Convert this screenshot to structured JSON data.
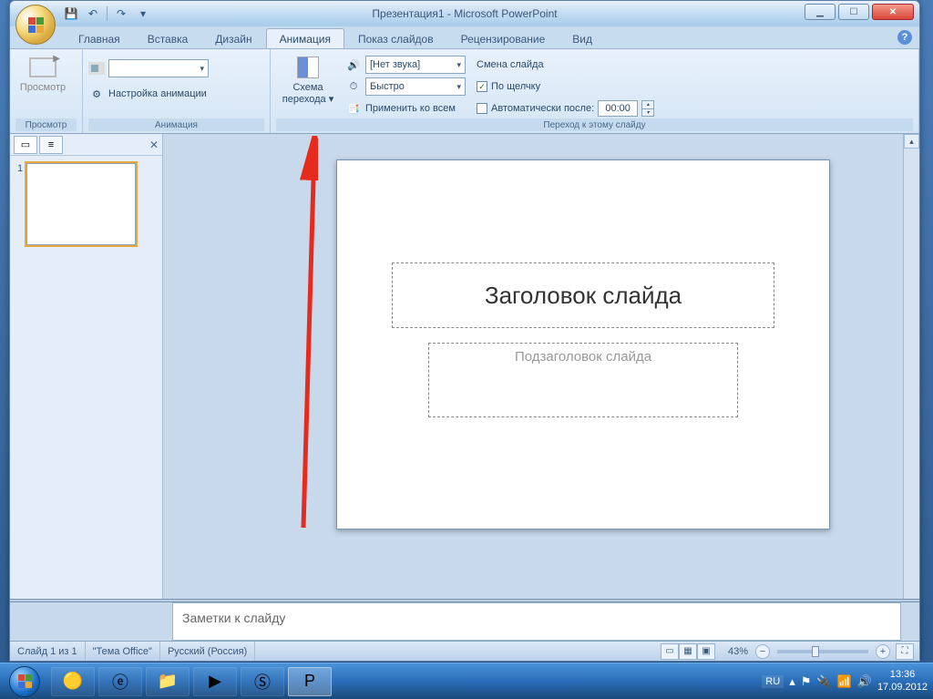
{
  "window": {
    "title": "Презентация1 - Microsoft PowerPoint"
  },
  "qat": {
    "save": "💾",
    "undo": "↶",
    "redo": "↷"
  },
  "tabs": {
    "home": "Главная",
    "insert": "Вставка",
    "design": "Дизайн",
    "animation": "Анимация",
    "slideshow": "Показ слайдов",
    "review": "Рецензирование",
    "view": "Вид"
  },
  "ribbon": {
    "preview": {
      "button": "Просмотр",
      "group": "Просмотр"
    },
    "animation": {
      "settings": "Настройка анимации",
      "group": "Анимация"
    },
    "transition": {
      "scheme": "Схема перехода",
      "sound_label": "[Нет звука]",
      "speed": "Быстро",
      "apply_all": "Применить ко всем",
      "change_header": "Смена слайда",
      "on_click": "По щелчку",
      "auto_after": "Автоматически после:",
      "auto_time": "00:00",
      "group": "Переход к этому слайду"
    }
  },
  "slide": {
    "title_placeholder": "Заголовок слайда",
    "subtitle_placeholder": "Подзаголовок слайда"
  },
  "thumbnails": {
    "num1": "1"
  },
  "notes": {
    "placeholder": "Заметки к слайду"
  },
  "status": {
    "slide": "Слайд 1 из 1",
    "theme": "\"Тема Office\"",
    "lang": "Русский (Россия)",
    "zoom": "43%"
  },
  "taskbar": {
    "lang": "RU",
    "time": "13:36",
    "date": "17.09.2012"
  }
}
